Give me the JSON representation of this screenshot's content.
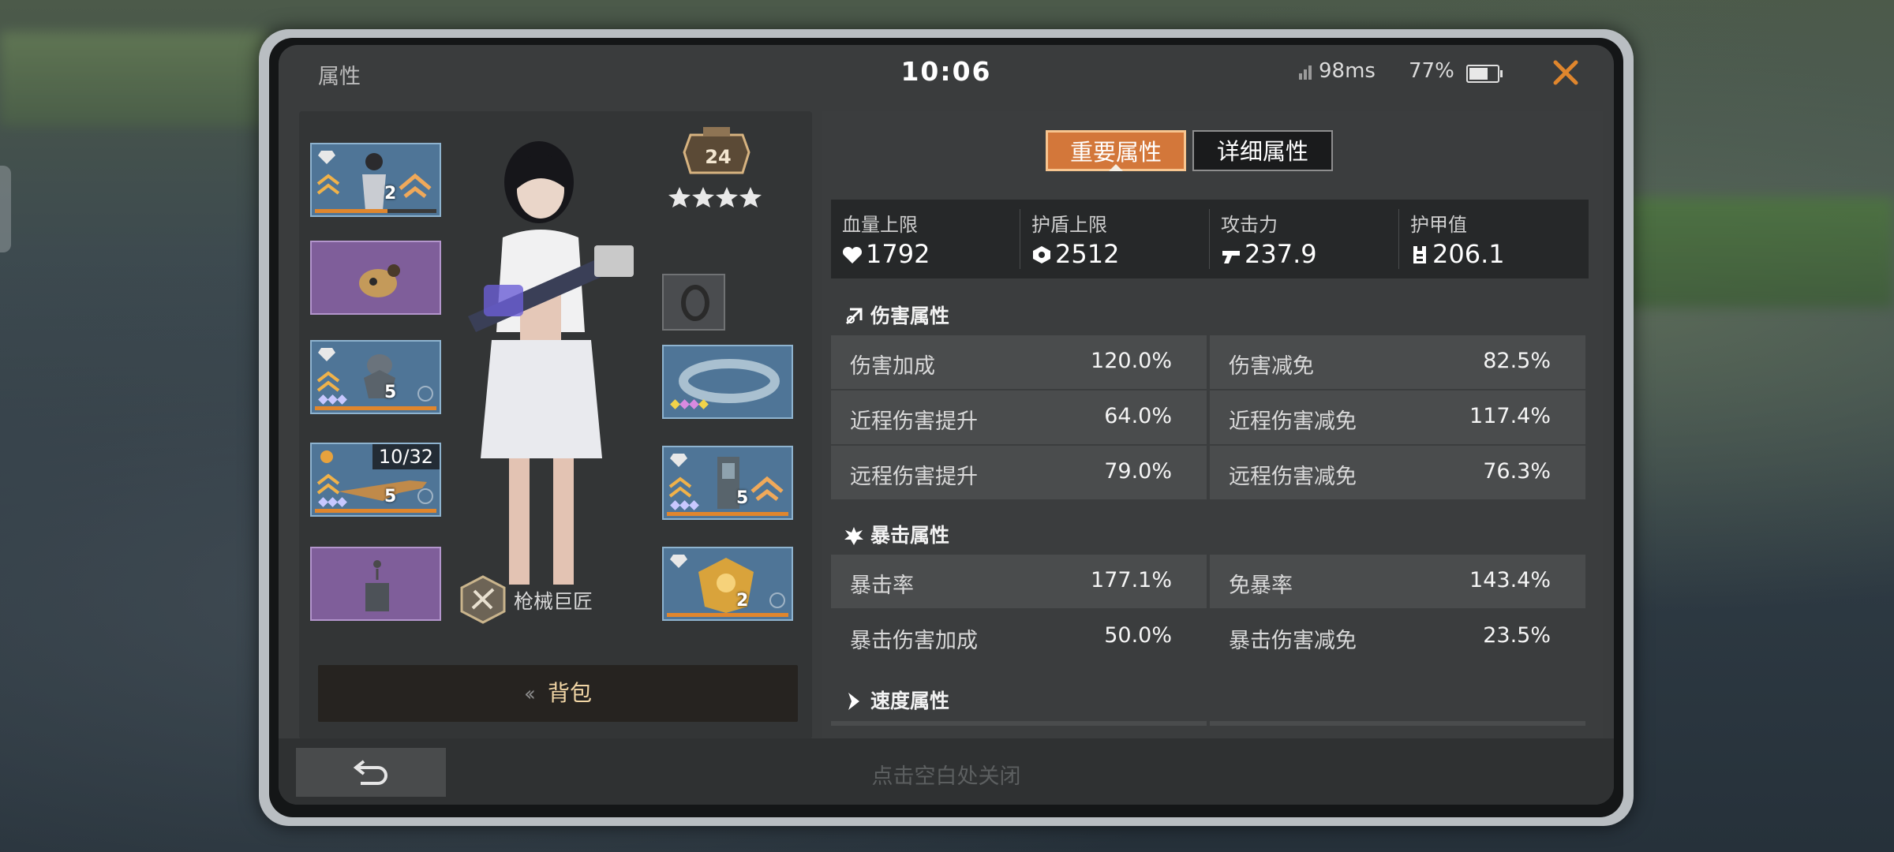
{
  "header": {
    "title": "属性",
    "clock": "10:06",
    "ping": "98ms",
    "battery": "77%",
    "battery_level": 0.77
  },
  "equipment": {
    "left_slots": [
      {
        "type": "character-card",
        "level": "2"
      },
      {
        "type": "purple-item"
      },
      {
        "type": "robot",
        "level": "5"
      },
      {
        "type": "rifle",
        "counter": "10/32",
        "level": "5"
      },
      {
        "type": "purple-device"
      }
    ],
    "right_slots": [
      {
        "type": "ring-small"
      },
      {
        "type": "bracelet"
      },
      {
        "type": "backpack-module",
        "level": "5"
      },
      {
        "type": "golden-armor",
        "level": "2"
      }
    ],
    "rank_level": "24",
    "rank_stars": 4,
    "class_name": "枪械巨匠",
    "bag_label": "背包"
  },
  "tabs": [
    {
      "label": "重要属性",
      "active": true
    },
    {
      "label": "详细属性",
      "active": false
    }
  ],
  "key_stats": [
    {
      "label": "血量上限",
      "value": "1792",
      "icon": "heart-icon"
    },
    {
      "label": "护盾上限",
      "value": "2512",
      "icon": "shield-icon"
    },
    {
      "label": "攻击力",
      "value": "237.9",
      "icon": "gun-icon"
    },
    {
      "label": "护甲值",
      "value": "206.1",
      "icon": "armor-icon"
    }
  ],
  "sections": {
    "damage": {
      "title": "伤害属性",
      "rows": [
        [
          {
            "label": "伤害加成",
            "value": "120.0%"
          },
          {
            "label": "伤害减免",
            "value": "82.5%"
          }
        ],
        [
          {
            "label": "近程伤害提升",
            "value": "64.0%"
          },
          {
            "label": "近程伤害减免",
            "value": "117.4%"
          }
        ],
        [
          {
            "label": "远程伤害提升",
            "value": "79.0%"
          },
          {
            "label": "远程伤害减免",
            "value": "76.3%"
          }
        ]
      ]
    },
    "crit": {
      "title": "暴击属性",
      "rows": [
        [
          {
            "label": "暴击率",
            "value": "177.1%"
          },
          {
            "label": "免暴率",
            "value": "143.4%"
          }
        ],
        [
          {
            "label": "暴击伤害加成",
            "value": "50.0%"
          },
          {
            "label": "暴击伤害减免",
            "value": "23.5%"
          }
        ]
      ]
    },
    "speed": {
      "title": "速度属性"
    }
  },
  "footer": {
    "hint": "点击空白处关闭"
  },
  "colors": {
    "accent": "#d3773a",
    "blue_slot": "#4f7597",
    "purple_slot": "#7f5e9a",
    "close": "#e0862d"
  }
}
